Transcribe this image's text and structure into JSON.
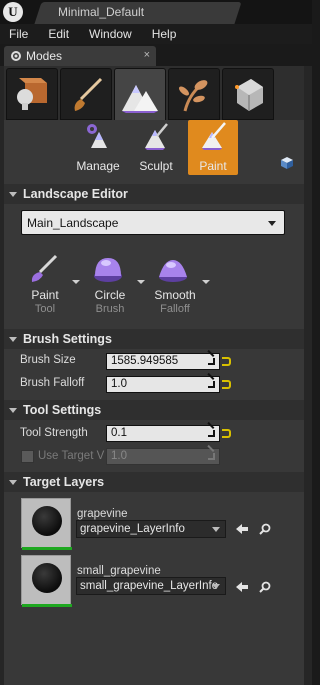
{
  "window": {
    "title": "Minimal_Default"
  },
  "menu": [
    "File",
    "Edit",
    "Window",
    "Help"
  ],
  "modes_tab": {
    "label": "Modes",
    "close_glyph": "×"
  },
  "mode_buttons": [
    {
      "icon": "place-mode-icon",
      "active": false
    },
    {
      "icon": "paint-mode-icon",
      "active": false
    },
    {
      "icon": "landscape-mode-icon",
      "active": true
    },
    {
      "icon": "foliage-mode-icon",
      "active": false
    },
    {
      "icon": "geometry-mode-icon",
      "active": false
    }
  ],
  "subtools": [
    {
      "label": "Manage",
      "icon": "manage-icon",
      "active": false
    },
    {
      "label": "Sculpt",
      "icon": "sculpt-icon",
      "active": false
    },
    {
      "label": "Paint",
      "icon": "paint-icon",
      "active": true
    }
  ],
  "landscape_editor": {
    "header": "Landscape Editor",
    "landscape_select": "Main_Landscape",
    "tools": [
      {
        "label": "Paint",
        "sub": "Tool"
      },
      {
        "label": "Circle",
        "sub": "Brush"
      },
      {
        "label": "Smooth",
        "sub": "Falloff"
      }
    ]
  },
  "brush_settings": {
    "header": "Brush Settings",
    "brush_size_label": "Brush Size",
    "brush_size_value": "1585.949585",
    "brush_falloff_label": "Brush Falloff",
    "brush_falloff_value": "1.0"
  },
  "tool_settings": {
    "header": "Tool Settings",
    "tool_strength_label": "Tool Strength",
    "tool_strength_value": "0.1",
    "use_target_label": "Use Target V",
    "use_target_value": "1.0"
  },
  "target_layers": {
    "header": "Target Layers",
    "layers": [
      {
        "name": "grapevine",
        "info": "grapevine_LayerInfo"
      },
      {
        "name": "small_grapevine",
        "info": "small_grapevine_LayerInfo"
      }
    ]
  },
  "colors": {
    "accent": "#e08a1e",
    "panel": "#383838",
    "layer_bar": "#1ea820",
    "reset_arrow": "#d8c000"
  }
}
